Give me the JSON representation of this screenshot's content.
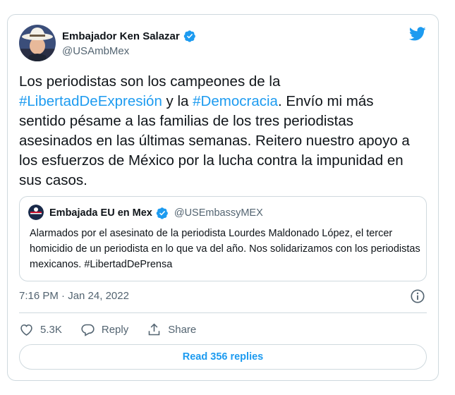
{
  "author": {
    "name": "Embajador Ken Salazar",
    "handle": "@USAmbMex"
  },
  "tweet": {
    "line1": "Los periodistas son los campeones de la",
    "tag1": "#LibertadDeExpresión",
    "mid": " y la ",
    "tag2": "#Democracia",
    "rest": ". Envío mi más sentido pésame a las familias de los tres periodistas asesinados en las últimas semanas. Reitero nuestro apoyo a los esfuerzos de México por la lucha contra la impunidad en sus casos."
  },
  "quote": {
    "name": "Embajada EU en Mex",
    "handle": "@USEmbassyMEX",
    "text": "Alarmados por el asesinato de la periodista Lourdes Maldonado López, el tercer homicidio de un periodista en lo que va del año. Nos solidarizamos con los periodistas mexicanos. #LibertadDePrensa"
  },
  "timestamp": "7:16 PM · Jan 24, 2022",
  "actions": {
    "like_count": "5.3K",
    "reply_label": "Reply",
    "share_label": "Share"
  },
  "read_replies_label": "Read 356 replies",
  "colors": {
    "accent": "#1d9bf0",
    "secondary_text": "#536471",
    "border": "#cfd9de"
  },
  "icons": [
    "twitter-logo-icon",
    "verified-badge-icon",
    "info-icon",
    "heart-icon",
    "reply-icon",
    "share-icon"
  ]
}
